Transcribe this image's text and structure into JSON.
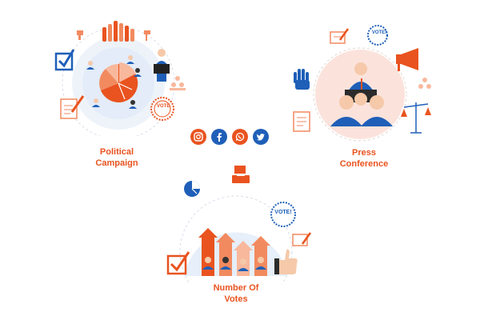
{
  "sections": [
    {
      "id": "political",
      "caption_line1": "Political",
      "caption_line2": "Campaign"
    },
    {
      "id": "press",
      "caption_line1": "Press",
      "caption_line2": "Conference"
    },
    {
      "id": "votes",
      "caption_line1": "Number Of",
      "caption_line2": "Votes"
    }
  ],
  "badges": {
    "vote_label": "VOTE!",
    "stamp_label": "VOTE"
  },
  "social": [
    {
      "name": "instagram-icon",
      "color": "#e9531f"
    },
    {
      "name": "facebook-icon",
      "color": "#1f5fb8"
    },
    {
      "name": "whatsapp-icon",
      "color": "#e9531f"
    },
    {
      "name": "twitter-icon",
      "color": "#1f5fb8"
    }
  ],
  "colors": {
    "orange": "#e9531f",
    "blue": "#1f5fb8",
    "light_blue": "#e6effa",
    "peach": "#fbe3dc"
  }
}
